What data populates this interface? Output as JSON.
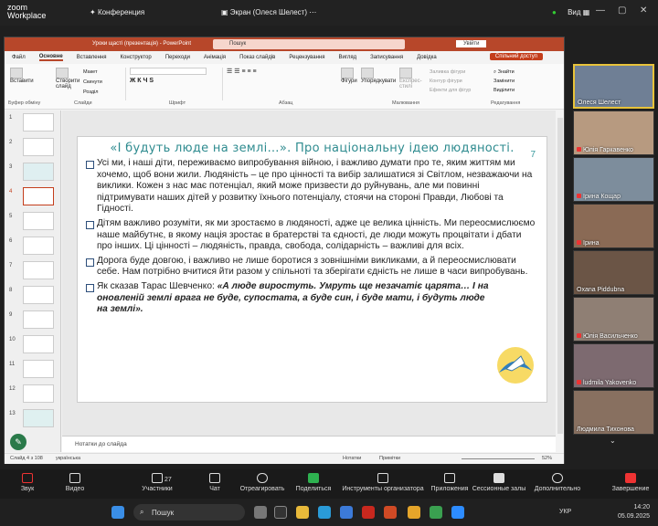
{
  "zoom": {
    "logo_line1": "zoom",
    "logo_line2": "Workplace",
    "meeting_label": "Конференция",
    "share_label": "Экран (Олеся Шелест)",
    "view_label": "Вид"
  },
  "ppt": {
    "doc_title": "Уроки щасті (презентація) - PowerPoint",
    "search_placeholder": "Пошук",
    "signin": "Увійти",
    "tabs": [
      "Файл",
      "Основне",
      "Вставлення",
      "Конструктор",
      "Переходи",
      "Анімація",
      "Показ слайдів",
      "Рецензування",
      "Вигляд",
      "Записування",
      "Довідка"
    ],
    "active_tab": "Основне",
    "share_button": "Спільний доступ",
    "ribbon": {
      "paste": "Вставити",
      "clipboard": "Буфер обміну",
      "new_slide": "Створити слайд",
      "layout": "Макет",
      "reset": "Скинути",
      "section": "Розділ",
      "slides": "Слайди",
      "font": "Шрифт",
      "paragraph": "Абзац",
      "shapes": "Фігури",
      "arrange": "Упорядкувати",
      "quick_styles": "Експрес-стилі",
      "drawing": "Малювання",
      "fill": "Заливка фігури",
      "outline": "Контур фігури",
      "effects": "Ефекти для фігур",
      "find": "Знайти",
      "replace": "Замінити",
      "select": "Виділити",
      "editing": "Редагування"
    },
    "thumb_numbers": [
      "1",
      "2",
      "3",
      "4",
      "5",
      "6",
      "7",
      "8",
      "9",
      "10",
      "11",
      "12",
      "13"
    ],
    "slide": {
      "title": "«І будуть люде на землі…». Про національну ідею людяності.",
      "number": "7",
      "bullets": [
        "Усі ми, і наші діти, переживаємо випробування війною, і важливо думати про те, яким життям ми хочемо, щоб вони жили. Людяність – це про цінності та вибір залишатися зі Світлом, незважаючи на виклики. Кожен з нас має потенціал, який може призвести до руйнувань, але ми повинні підтримувати наших дітей у розвитку їхнього потенціалу, стоячи на стороні Правди, Любові та Гідності.",
        "Дітям важливо розуміти, як ми зростаємо в людяності, адже це велика цінність. Ми переосмислюємо наше майбутнє, в якому нація зростає в братерстві та єдності, де люди можуть процвітати і дбати про інших. Ці цінності – людяність, правда, свобода, солідарність – важливі для всіх.",
        "Дорога буде довгою, і важливо не лише боротися з зовнішніми викликами, а й переосмислювати себе. Нам потрібно вчитися йти разом у спільноті та зберігати єдність не лише в часи випробувань."
      ],
      "quote_prefix": "Як сказав Тарас Шевченко: ",
      "quote_text": "«А люде виростуть. Умруть ще незачатіє царята… І на оновленій землі врага не буде, супостата, а буде син, і буде мати, і будуть люде на землі»."
    },
    "notes_placeholder": "Нотатки до слайда",
    "status": {
      "slide_info": "Слайд 4 з 108",
      "language": "українська",
      "notes": "Нотатки",
      "comments": "Примітки",
      "zoom": "52%"
    }
  },
  "participants": [
    {
      "name": "Олеся Шелест",
      "color": "#6f7f95"
    },
    {
      "name": "Юлія Гаркавенко",
      "color": "#b79a80"
    },
    {
      "name": "Ірина Кощар",
      "color": "#7d8d9c"
    },
    {
      "name": "Ірина",
      "color": "#8a6a55"
    },
    {
      "name": "Oxana Piddubna",
      "color": "#6b5546"
    },
    {
      "name": "Юлія Васильченко",
      "color": "#8f7f74"
    },
    {
      "name": "ludmila Yakovenko",
      "color": "#7d6a70"
    },
    {
      "name": "Людмила Тихонова",
      "color": "#887060"
    }
  ],
  "toolbar": {
    "audio": "Звук",
    "video": "Видео",
    "participants": "Участники",
    "participants_count": "27",
    "chat": "Чат",
    "react": "Отреагировать",
    "share": "Поделиться",
    "host_tools": "Инструменты организатора",
    "apps": "Приложения",
    "breakout": "Сессионные залы",
    "more": "Дополнительно",
    "end": "Завершение"
  },
  "taskbar": {
    "search": "Пошук",
    "lang": "УКР",
    "time": "14:20",
    "date": "05.09.2025"
  }
}
